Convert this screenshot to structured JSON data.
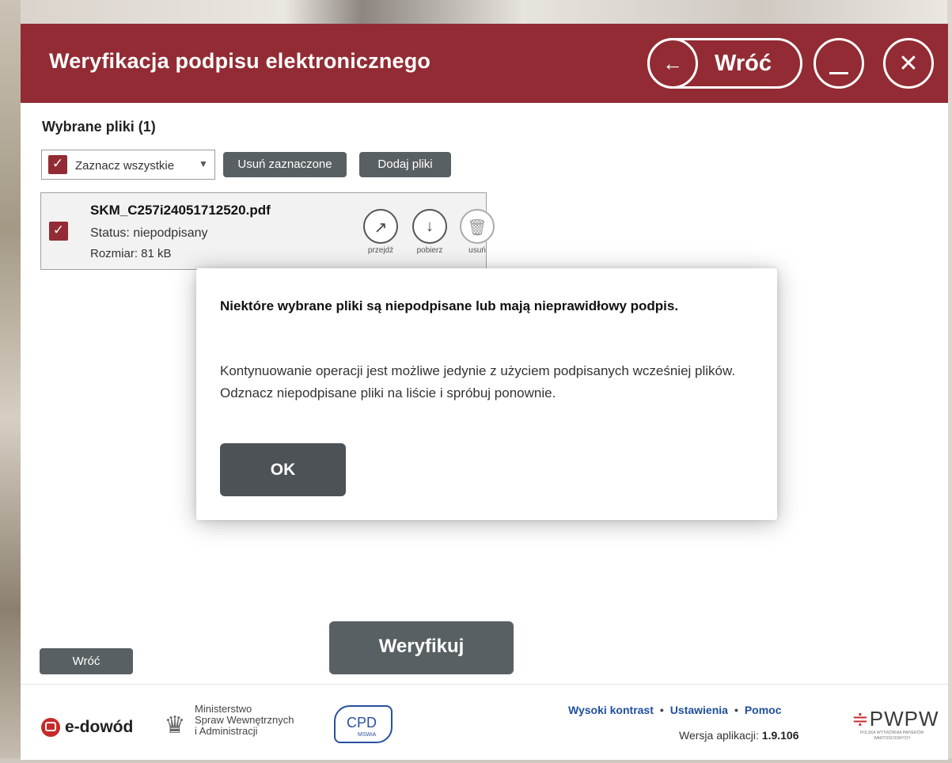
{
  "header": {
    "title": "Weryfikacja podpisu elektronicznego",
    "back_label": "Wróć",
    "back_icon": "←",
    "close_icon": "✕"
  },
  "files_section": {
    "title": "Wybrane pliki (1)",
    "select_all_label": "Zaznacz wszystkie",
    "select_all_checked": true,
    "remove_selected_label": "Usuń zaznaczone",
    "add_files_label": "Dodaj pliki",
    "files": [
      {
        "name": "SKM_C257i24051712520.pdf",
        "status": "Status: niepodpisany",
        "size": "Rozmiar: 81 kB",
        "checked": true,
        "actions": {
          "open_label": "przejdź",
          "download_label": "pobierz",
          "delete_label": "usuń"
        }
      }
    ]
  },
  "modal": {
    "title": "Niektóre wybrane pliki są niepodpisane lub mają nieprawidłowy podpis.",
    "body": "Kontynuowanie operacji jest możliwe jedynie z użyciem podpisanych wcześniej plików. Odznacz niepodpisane pliki na liście i spróbuj ponownie.",
    "ok_label": "OK"
  },
  "actions": {
    "verify_label": "Weryfikuj",
    "back_label": "Wróć"
  },
  "footer": {
    "edowod": "e-dowód",
    "ministry_lines": [
      "Ministerstwo",
      "Spraw Wewnętrznych",
      "i Administracji"
    ],
    "cpd": "CPD",
    "cpd_sub": "MSWiA",
    "links": [
      "Wysoki kontrast",
      "Ustawienia",
      "Pomoc"
    ],
    "version_label": "Wersja aplikacji:",
    "version_value": "1.9.106",
    "pwpw": "PWPW",
    "pwpw_sub": "POLSKA WYTWÓRNIA PAPIERÓW WARTOŚCIOWYCH"
  },
  "colors": {
    "brand": "#922b33",
    "button_gray": "#596064"
  }
}
